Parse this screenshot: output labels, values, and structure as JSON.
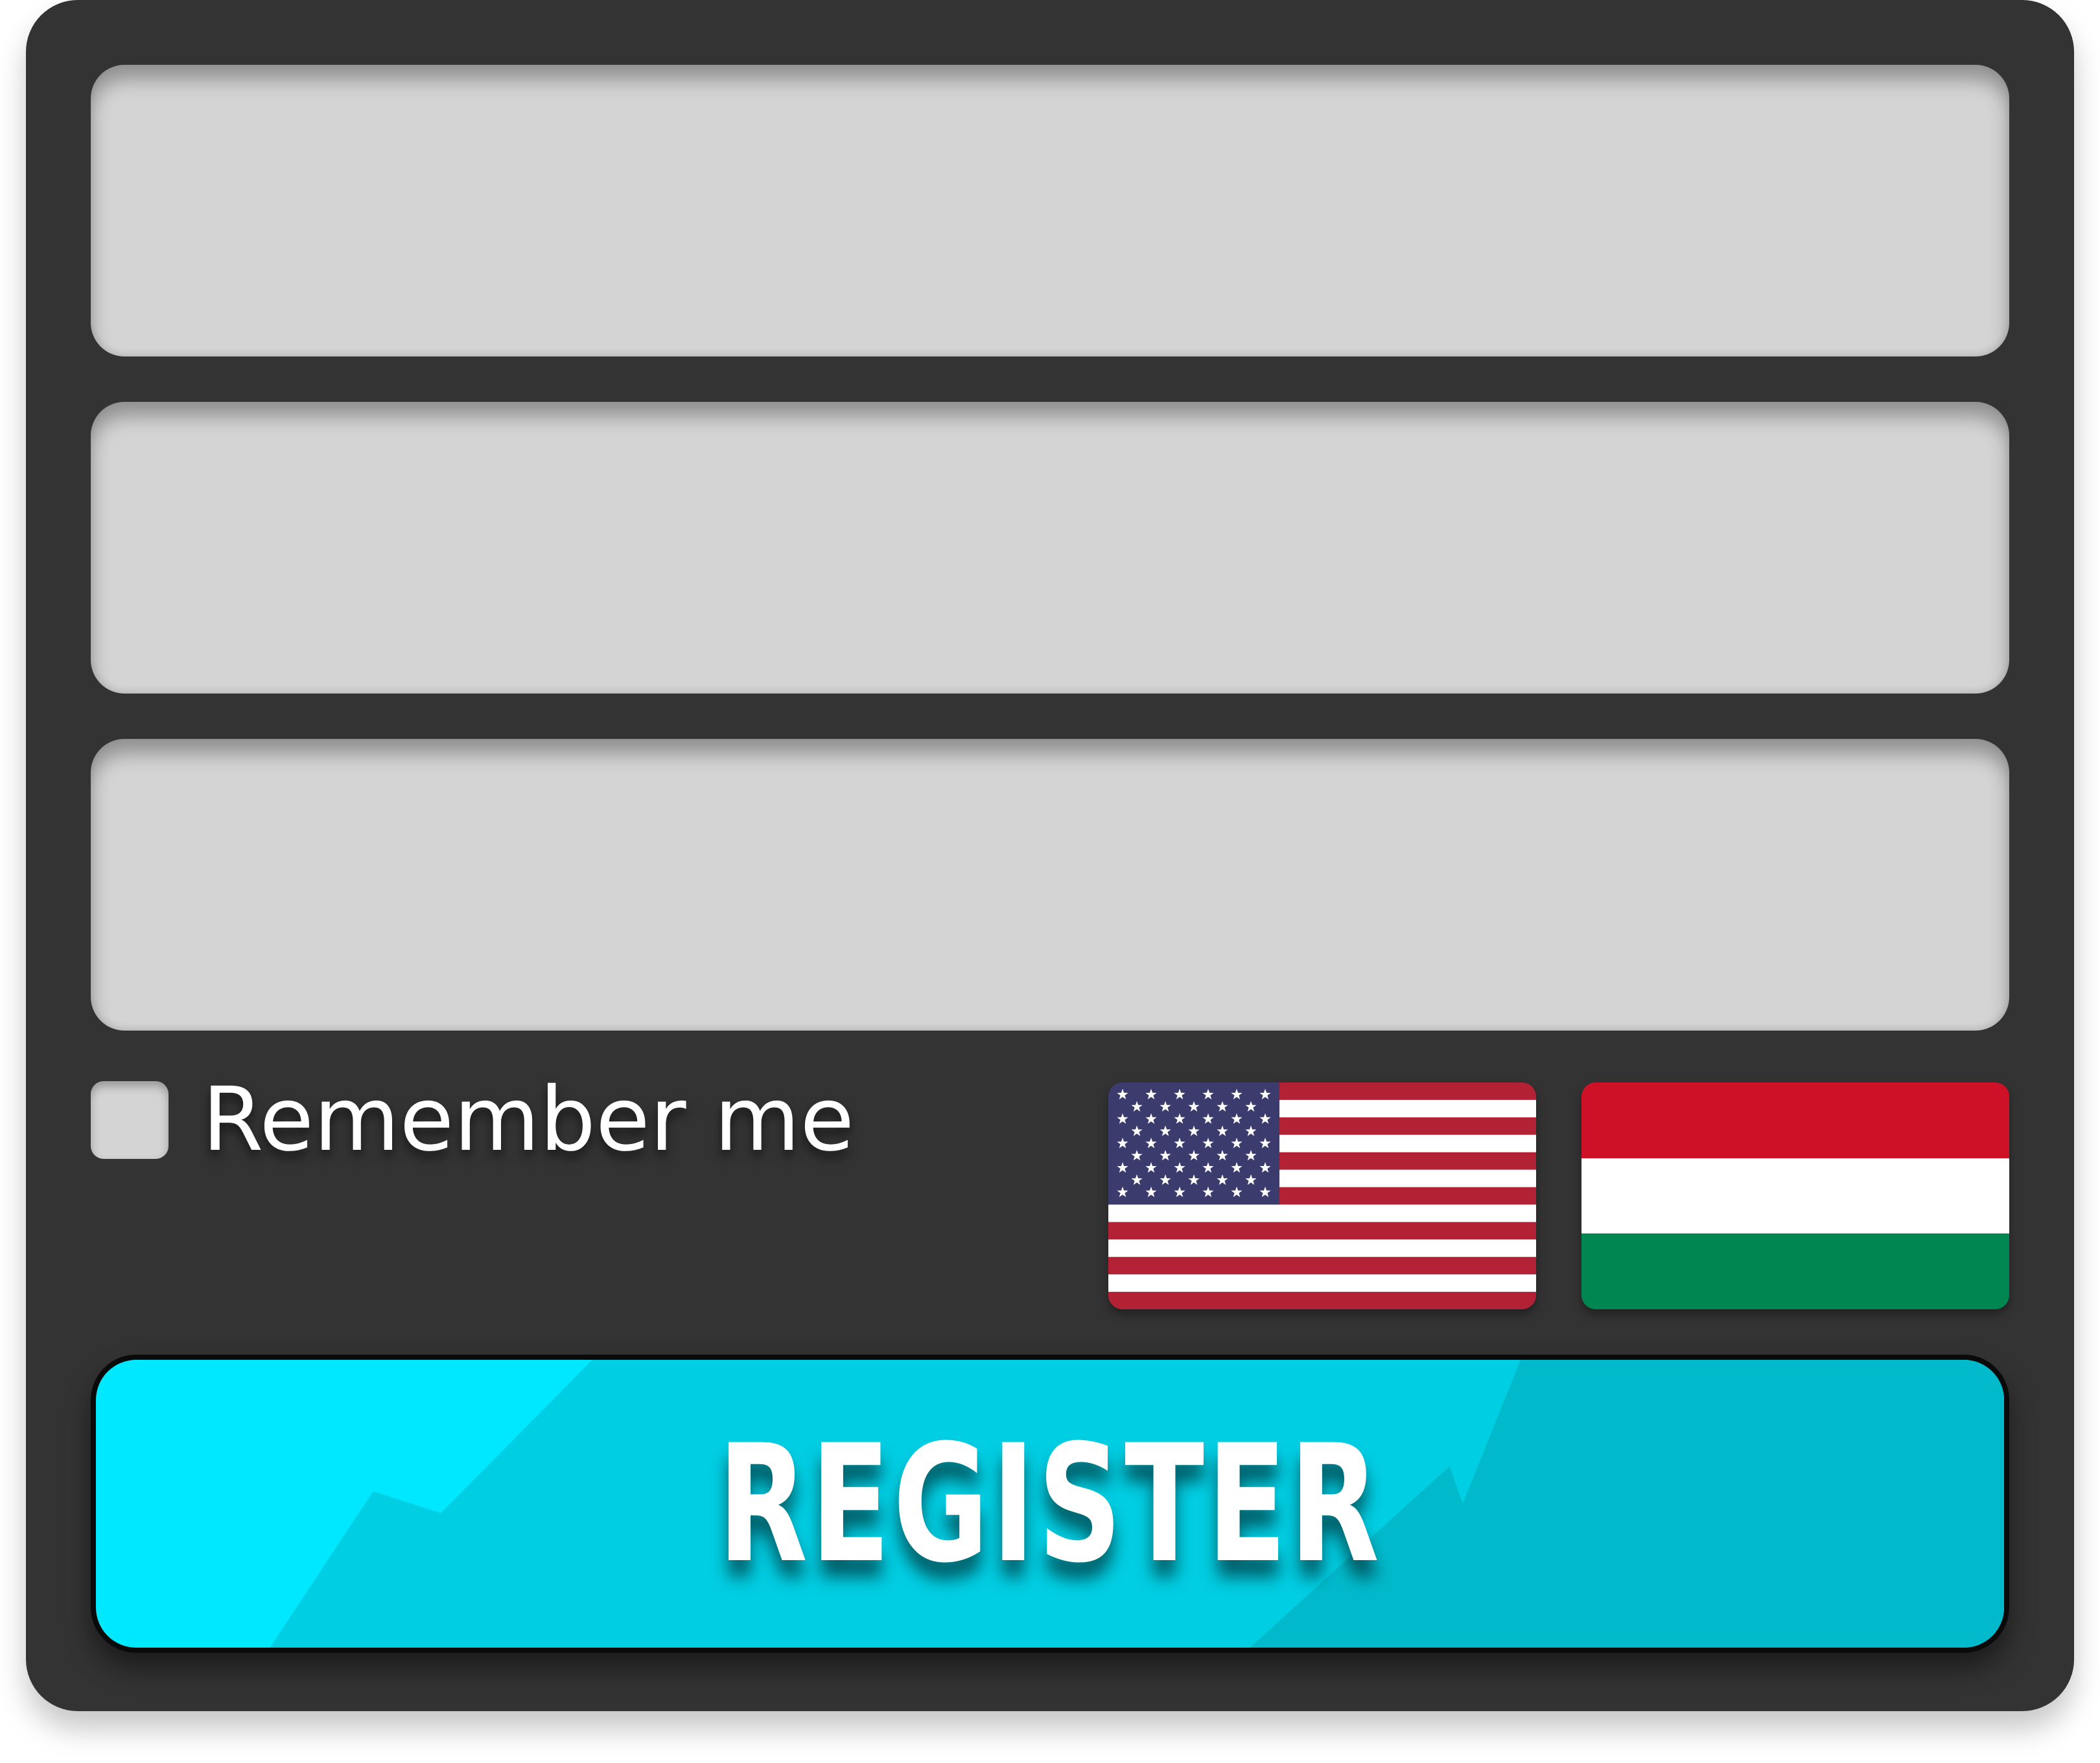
{
  "form": {
    "fields": [
      {
        "value": "",
        "placeholder": ""
      },
      {
        "value": "",
        "placeholder": ""
      },
      {
        "value": "",
        "placeholder": ""
      }
    ],
    "remember": {
      "label": "Remember me",
      "checked": false
    },
    "languages": [
      {
        "name": "united-states-flag-icon",
        "colors": [
          "#B22234",
          "#FFFFFF",
          "#3C3B6E"
        ]
      },
      {
        "name": "hungary-flag-icon",
        "colors": [
          "#CE1126",
          "#FFFFFF",
          "#008751"
        ]
      }
    ],
    "submit": {
      "label": "REGISTER",
      "color_light": "#00E8FF",
      "color_dark": "#00B8CC"
    }
  }
}
